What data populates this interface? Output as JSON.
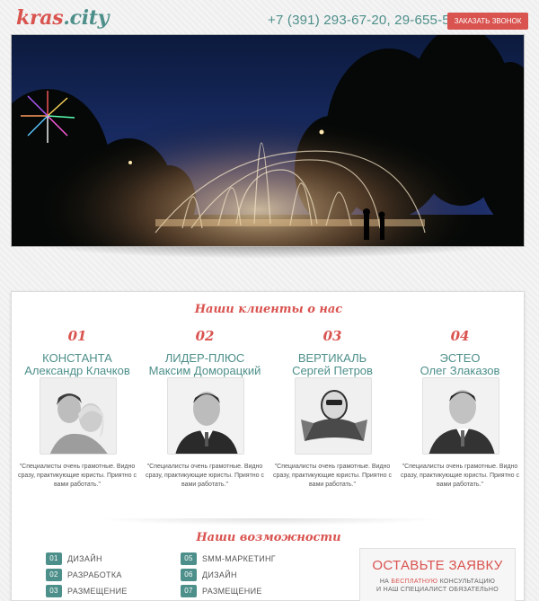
{
  "header": {
    "logo_part1": "kras",
    "logo_part2": ".city",
    "phone": "+7 (391) 293-67-20, 29-655-59",
    "callback_label": "ЗАКАЗАТЬ ЗВОНОК"
  },
  "clients": {
    "title": "Наши клиенты о нас",
    "items": [
      {
        "num": "01",
        "company": "КОНСТАНТА",
        "person": "Александр Клачков",
        "quote": "\"Специалисты очень грамотные. Видно сразу, практикующие юристы. Приятно с вами работать.\""
      },
      {
        "num": "02",
        "company": "ЛИДЕР-ПЛЮС",
        "person": "Максим Доморацкий",
        "quote": "\"Специалисты очень грамотные. Видно сразу, практикующие юристы. Приятно с вами работать.\""
      },
      {
        "num": "03",
        "company": "ВЕРТИКАЛЬ",
        "person": "Сергей Петров",
        "quote": "\"Специалисты очень грамотные. Видно сразу, практикующие юристы. Приятно с вами работать.\""
      },
      {
        "num": "04",
        "company": "ЭСТЕО",
        "person": "Олег Злаказов",
        "quote": "\"Специалисты очень грамотные. Видно сразу, практикующие юристы. Приятно с вами работать.\""
      }
    ]
  },
  "capabilities": {
    "title": "Наши возможности",
    "left": [
      {
        "num": "01",
        "label": "ДИЗАЙН"
      },
      {
        "num": "02",
        "label": "РАЗРАБОТКА"
      },
      {
        "num": "03",
        "label": "РАЗМЕЩЕНИЕ"
      }
    ],
    "right": [
      {
        "num": "05",
        "label": "SMM-МАРКЕТИНГ"
      },
      {
        "num": "06",
        "label": "ДИЗАЙН"
      },
      {
        "num": "07",
        "label": "РАЗМЕЩЕНИЕ"
      }
    ]
  },
  "order": {
    "heading": "ОСТАВЬТЕ ЗАЯВКУ",
    "text_before": "НА",
    "text_highlight": "БЕСПЛАТНУЮ",
    "text_after": "КОНСУЛЬТАЦИЮ",
    "text_line2": "И НАШ СПЕЦИАЛИСТ ОБЯЗАТЕЛЬНО"
  },
  "colors": {
    "accent_red": "#d9534f",
    "accent_teal": "#4d8f8a"
  }
}
